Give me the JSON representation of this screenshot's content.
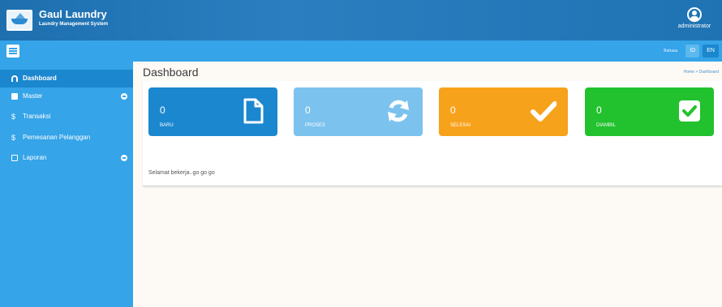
{
  "header": {
    "app_title": "Gaul Laundry",
    "app_subtitle": "Laundry Management System",
    "user_name": "administrator"
  },
  "navbar": {
    "language_label": "Bahasa",
    "languages": [
      "ID",
      "EN"
    ],
    "active_language": "EN"
  },
  "sidebar": {
    "items": [
      {
        "label": "Dashboard",
        "icon": "dashboard-icon",
        "active": true
      },
      {
        "label": "Master",
        "icon": "box-icon",
        "expandable": true
      },
      {
        "label": "Transaksi",
        "icon": "dollar-icon"
      },
      {
        "label": "Pemesanan Pelanggan",
        "icon": "dollar-icon"
      },
      {
        "label": "Laporan",
        "icon": "file-icon",
        "expandable": true
      }
    ]
  },
  "main": {
    "page_title": "Dashboard",
    "breadcrumb": "Home > Dashboard",
    "cards": [
      {
        "count": "0",
        "label": "BARU",
        "icon": "file-icon",
        "color": "#1b87cf"
      },
      {
        "count": "0",
        "label": "PROSES",
        "icon": "refresh-icon",
        "color": "#7cc2ee"
      },
      {
        "count": "0",
        "label": "SELESAI",
        "icon": "check-icon",
        "color": "#f7a21b"
      },
      {
        "count": "0",
        "label": "DIAMBIL",
        "icon": "checkbox-icon",
        "color": "#22c22e"
      }
    ],
    "welcome_text": "Selamat bekerja..go go go"
  }
}
